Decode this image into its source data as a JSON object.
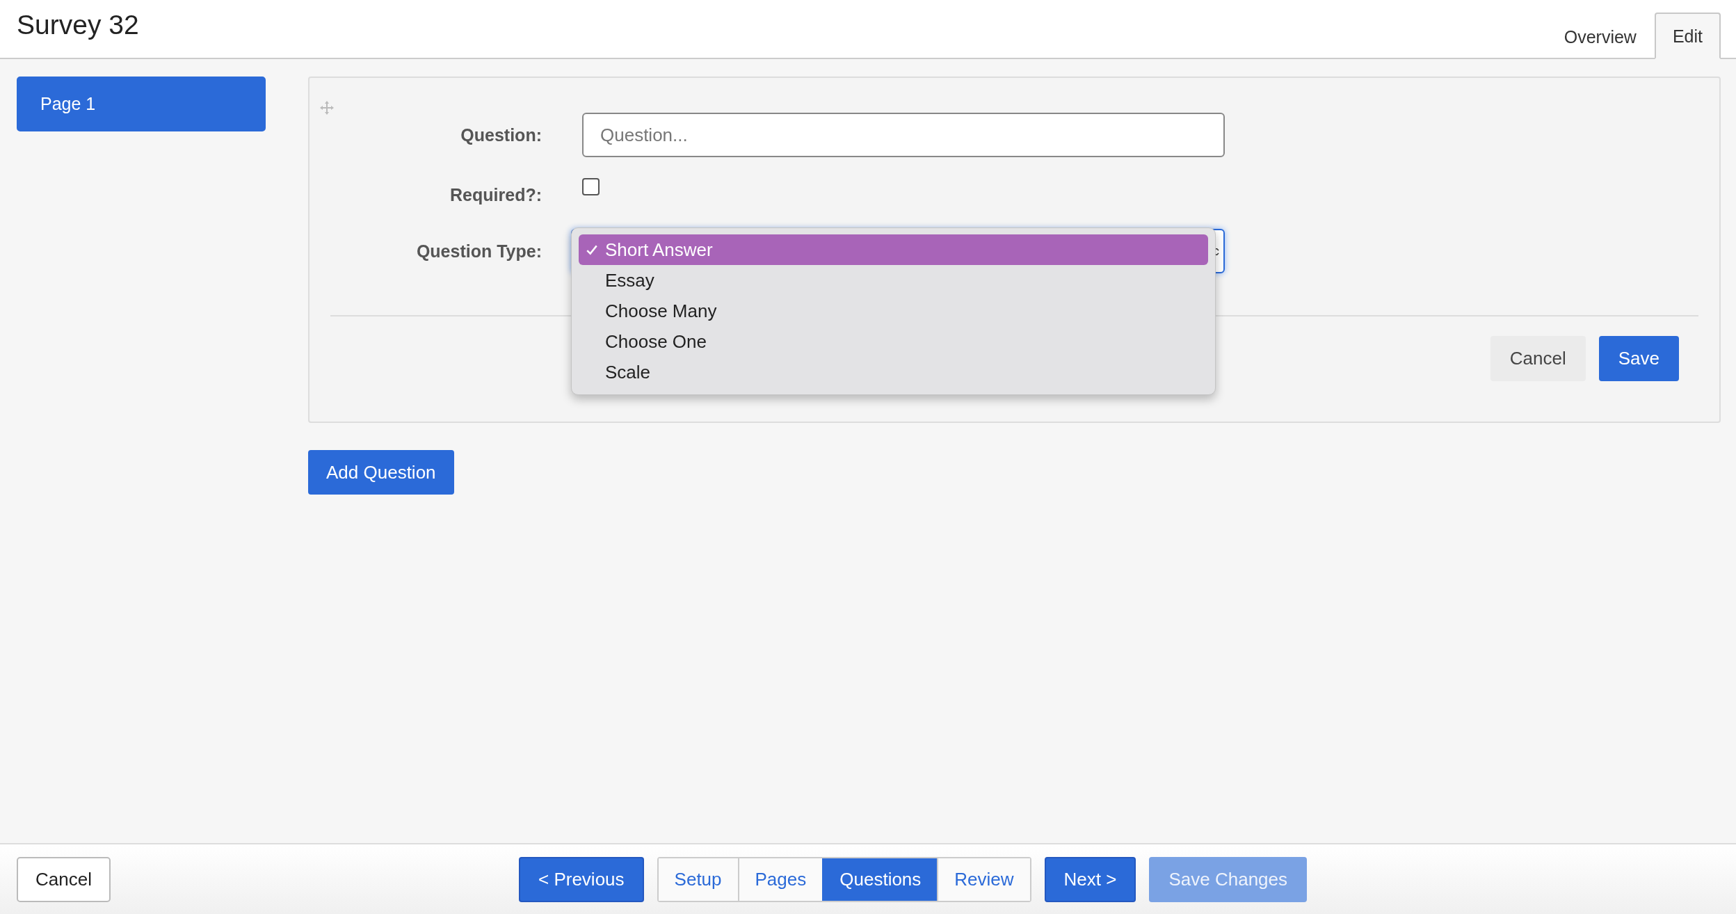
{
  "title": "Survey 32",
  "header_tabs": [
    {
      "label": "Overview",
      "selected": false
    },
    {
      "label": "Edit",
      "selected": true
    }
  ],
  "pages": [
    {
      "label": "Page 1",
      "selected": true
    }
  ],
  "form": {
    "question": {
      "label": "Question:",
      "placeholder": "Question..."
    },
    "required": {
      "label": "Required?:",
      "checked": false
    },
    "question_type": {
      "label": "Question Type:",
      "options": [
        {
          "label": "Short Answer",
          "selected": true
        },
        {
          "label": "Essay",
          "selected": false
        },
        {
          "label": "Choose Many",
          "selected": false
        },
        {
          "label": "Choose One",
          "selected": false
        },
        {
          "label": "Scale",
          "selected": false
        }
      ]
    },
    "buttons": [
      {
        "label": "Cancel",
        "kind": "secondary"
      },
      {
        "label": "Save",
        "kind": "primary"
      }
    ]
  },
  "add_question": "Add Question",
  "footer": {
    "cancel": "Cancel",
    "previous": "< Previous",
    "steps": [
      {
        "label": "Setup",
        "selected": false
      },
      {
        "label": "Pages",
        "selected": false
      },
      {
        "label": "Questions",
        "selected": true
      },
      {
        "label": "Review",
        "selected": false
      }
    ],
    "next": "Next >",
    "save_changes": {
      "label": "Save Changes",
      "disabled": true
    }
  }
}
